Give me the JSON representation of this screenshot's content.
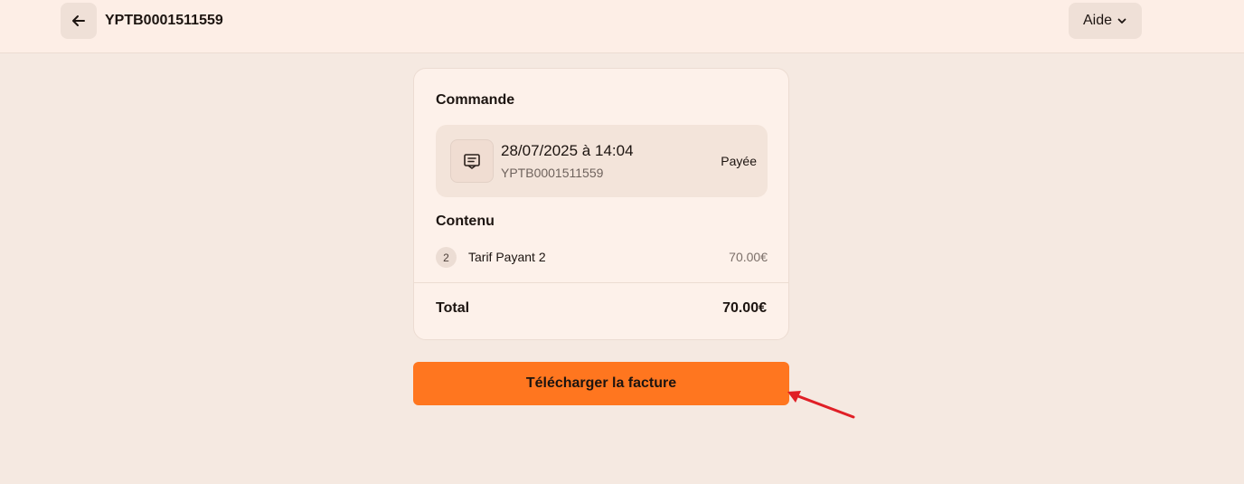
{
  "header": {
    "back_icon": "arrow-left-icon",
    "title": "YPTB0001511559",
    "help_label": "Aide",
    "help_icon": "chevron-down-icon"
  },
  "order": {
    "section_title": "Commande",
    "icon": "receipt-icon",
    "datetime": "28/07/2025 à 14:04",
    "reference": "YPTB0001511559",
    "status": "Payée"
  },
  "content": {
    "section_title": "Contenu",
    "items": [
      {
        "quantity": "2",
        "name": "Tarif Payant 2",
        "price": "70.00€"
      }
    ]
  },
  "total": {
    "label": "Total",
    "value": "70.00€"
  },
  "actions": {
    "download_label": "Télécharger la facture"
  },
  "colors": {
    "page_background": "#f5e9e1",
    "header_background": "#fdeee6",
    "card_background": "#fdf1ea",
    "accent": "#ff761f",
    "annotation": "#e01f26"
  }
}
